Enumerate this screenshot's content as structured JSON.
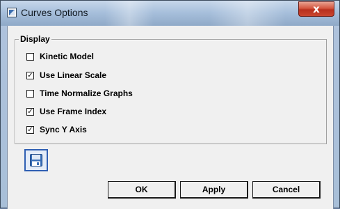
{
  "window": {
    "title": "Curves Options",
    "close_label": "x"
  },
  "display": {
    "legend": "Display",
    "options": [
      {
        "label": "Kinetic Model",
        "checked": false
      },
      {
        "label": "Use Linear Scale",
        "checked": true
      },
      {
        "label": "Time Normalize Graphs",
        "checked": false
      },
      {
        "label": "Use Frame Index",
        "checked": true
      },
      {
        "label": "Sync Y Axis",
        "checked": true
      }
    ]
  },
  "buttons": {
    "ok": "OK",
    "apply": "Apply",
    "cancel": "Cancel"
  },
  "icons": {
    "save": "floppy-disk-icon",
    "app": "window-app-icon",
    "close": "close-icon"
  },
  "colors": {
    "dialog_bg": "#f0f0f0",
    "accent": "#2f5fb3",
    "close_red": "#c9452f"
  }
}
